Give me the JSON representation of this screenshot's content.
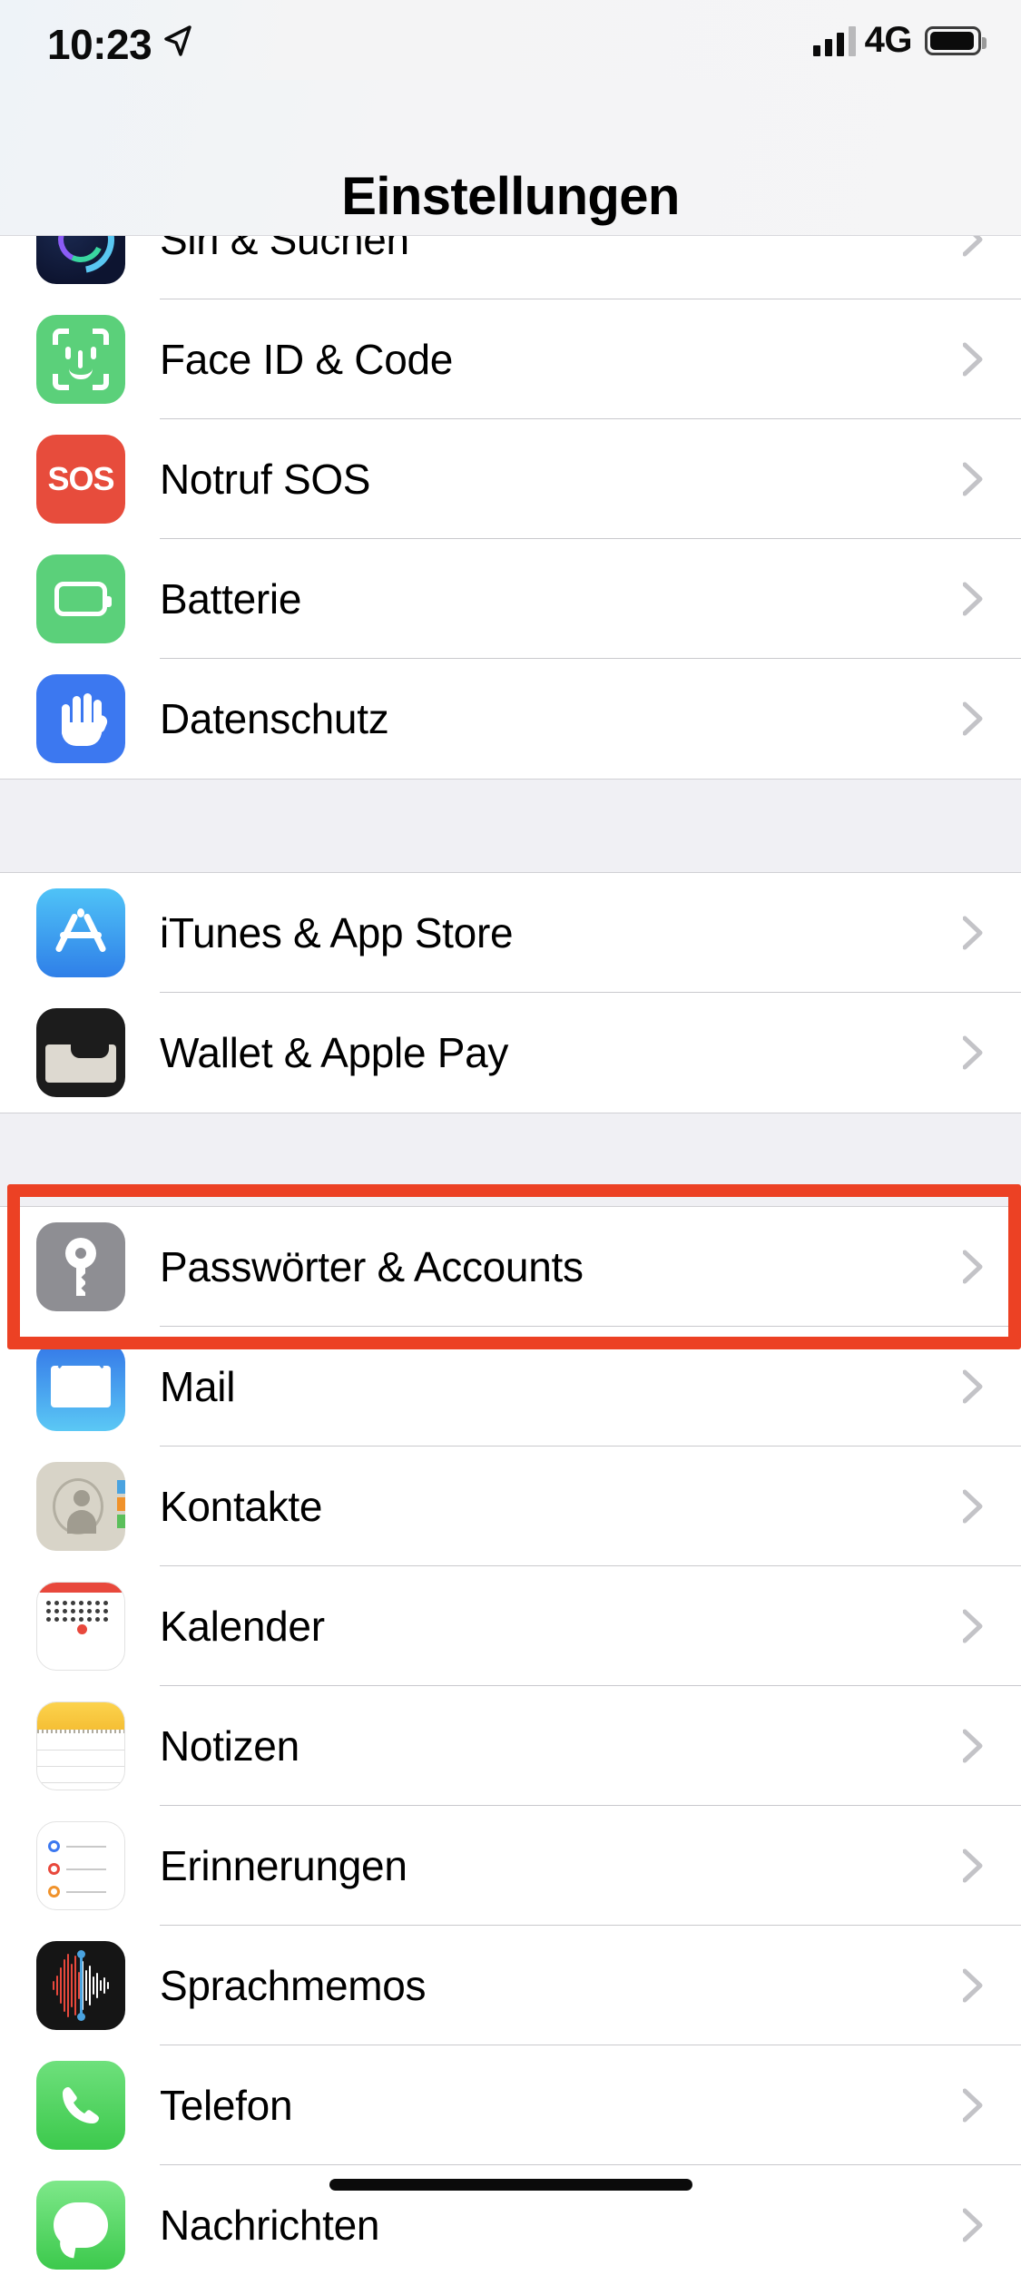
{
  "status_bar": {
    "time": "10:23",
    "location_icon": "location-arrow-icon",
    "signal_icon": "cellular-signal-icon",
    "carrier": "4G",
    "battery_icon": "battery-full-icon"
  },
  "nav": {
    "title": "Einstellungen"
  },
  "highlight": {
    "color": "#ec4124",
    "target": "Passwörter & Accounts"
  },
  "sections": [
    {
      "rows": [
        {
          "label": "Siri & Suchen",
          "icon": "siri-icon",
          "chevron": "chevron-right-icon",
          "partial": true
        },
        {
          "label": "Face ID & Code",
          "icon": "face-id-icon",
          "chevron": "chevron-right-icon"
        },
        {
          "label": "Notruf SOS",
          "icon": "sos-icon",
          "chevron": "chevron-right-icon"
        },
        {
          "label": "Batterie",
          "icon": "battery-icon",
          "chevron": "chevron-right-icon"
        },
        {
          "label": "Datenschutz",
          "icon": "privacy-hand-icon",
          "chevron": "chevron-right-icon"
        }
      ]
    },
    {
      "rows": [
        {
          "label": "iTunes & App Store",
          "icon": "app-store-icon",
          "chevron": "chevron-right-icon"
        },
        {
          "label": "Wallet & Apple Pay",
          "icon": "wallet-icon",
          "chevron": "chevron-right-icon"
        }
      ]
    },
    {
      "rows": [
        {
          "label": "Passwörter & Accounts",
          "icon": "key-icon",
          "chevron": "chevron-right-icon",
          "highlighted": true
        },
        {
          "label": "Mail",
          "icon": "mail-icon",
          "chevron": "chevron-right-icon"
        },
        {
          "label": "Kontakte",
          "icon": "contacts-icon",
          "chevron": "chevron-right-icon"
        },
        {
          "label": "Kalender",
          "icon": "calendar-icon",
          "chevron": "chevron-right-icon"
        },
        {
          "label": "Notizen",
          "icon": "notes-icon",
          "chevron": "chevron-right-icon"
        },
        {
          "label": "Erinnerungen",
          "icon": "reminders-icon",
          "chevron": "chevron-right-icon"
        },
        {
          "label": "Sprachmemos",
          "icon": "voice-memos-icon",
          "chevron": "chevron-right-icon"
        },
        {
          "label": "Telefon",
          "icon": "phone-icon",
          "chevron": "chevron-right-icon"
        },
        {
          "label": "Nachrichten",
          "icon": "messages-icon",
          "chevron": "chevron-right-icon",
          "partial": true
        }
      ]
    }
  ]
}
